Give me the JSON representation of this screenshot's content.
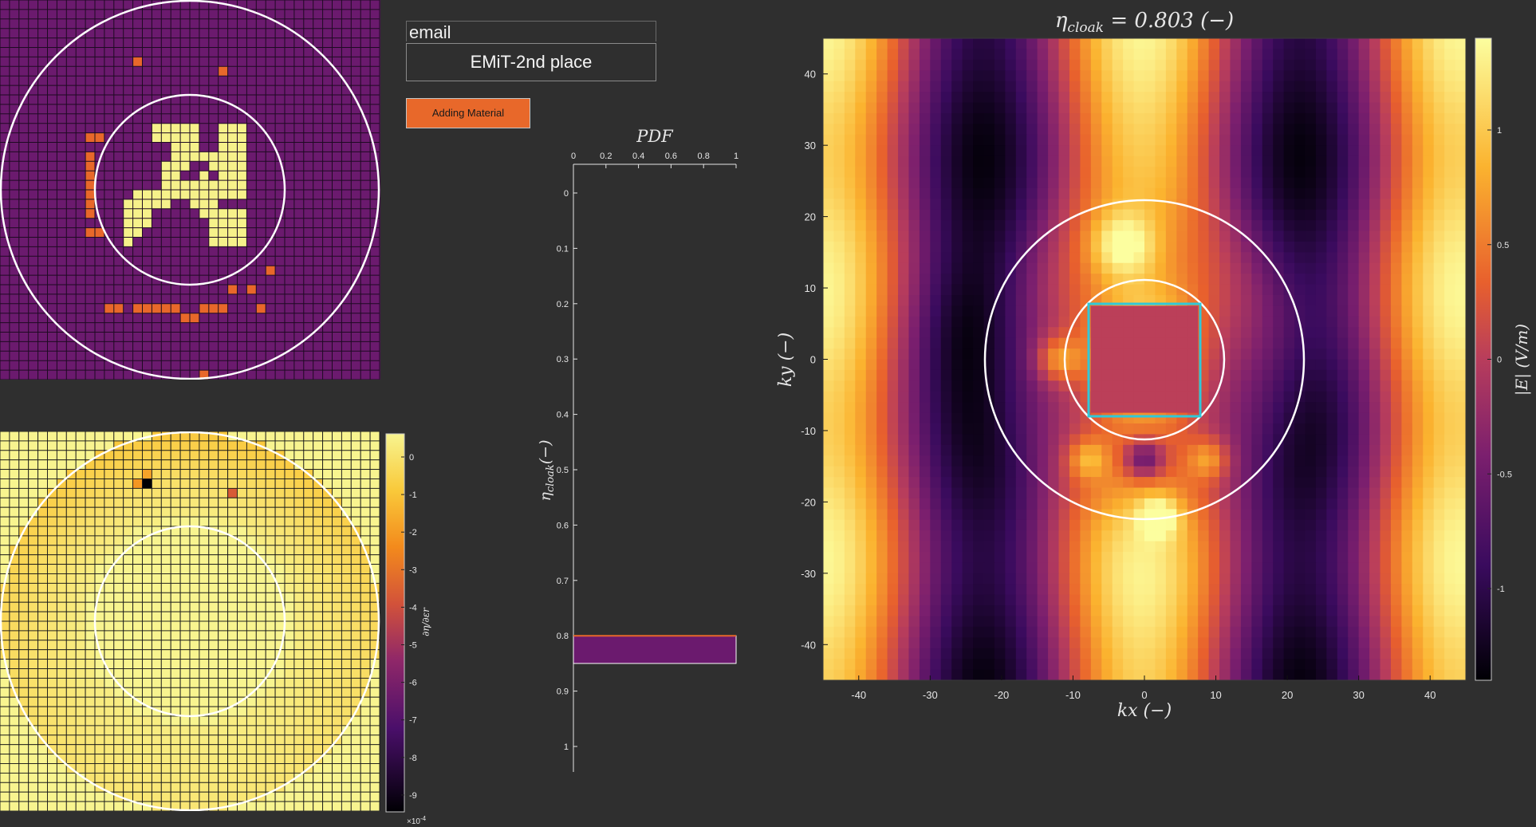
{
  "controls": {
    "email_value": "email",
    "team_label": "EMiT-2nd place",
    "adding_material_label": "Adding Material"
  },
  "colors": {
    "background": "#2f2f2f",
    "design_bg": "#6b1a6e",
    "design_material": "#f6f18a",
    "design_adding": "#e8682a",
    "cloak_outline": "#30c8d8",
    "circle": "#ffffff"
  },
  "design_grid": {
    "cells": 40,
    "material_cells": [
      [
        16,
        13
      ],
      [
        17,
        13
      ],
      [
        18,
        13
      ],
      [
        19,
        13
      ],
      [
        20,
        13
      ],
      [
        23,
        13
      ],
      [
        24,
        13
      ],
      [
        25,
        13
      ],
      [
        16,
        14
      ],
      [
        17,
        14
      ],
      [
        18,
        14
      ],
      [
        19,
        14
      ],
      [
        20,
        14
      ],
      [
        23,
        14
      ],
      [
        24,
        14
      ],
      [
        25,
        14
      ],
      [
        18,
        15
      ],
      [
        19,
        15
      ],
      [
        20,
        15
      ],
      [
        23,
        15
      ],
      [
        24,
        15
      ],
      [
        25,
        15
      ],
      [
        18,
        16
      ],
      [
        19,
        16
      ],
      [
        20,
        16
      ],
      [
        21,
        16
      ],
      [
        22,
        16
      ],
      [
        23,
        16
      ],
      [
        24,
        16
      ],
      [
        25,
        16
      ],
      [
        17,
        17
      ],
      [
        18,
        17
      ],
      [
        19,
        17
      ],
      [
        22,
        17
      ],
      [
        23,
        17
      ],
      [
        24,
        17
      ],
      [
        25,
        17
      ],
      [
        17,
        18
      ],
      [
        18,
        18
      ],
      [
        21,
        18
      ],
      [
        23,
        18
      ],
      [
        24,
        18
      ],
      [
        25,
        18
      ],
      [
        17,
        19
      ],
      [
        18,
        19
      ],
      [
        19,
        19
      ],
      [
        20,
        19
      ],
      [
        21,
        19
      ],
      [
        22,
        19
      ],
      [
        23,
        19
      ],
      [
        24,
        19
      ],
      [
        25,
        19
      ],
      [
        14,
        20
      ],
      [
        15,
        20
      ],
      [
        16,
        20
      ],
      [
        17,
        20
      ],
      [
        18,
        20
      ],
      [
        19,
        20
      ],
      [
        20,
        20
      ],
      [
        21,
        20
      ],
      [
        22,
        20
      ],
      [
        23,
        20
      ],
      [
        24,
        20
      ],
      [
        25,
        20
      ],
      [
        13,
        21
      ],
      [
        14,
        21
      ],
      [
        15,
        21
      ],
      [
        16,
        21
      ],
      [
        17,
        21
      ],
      [
        20,
        21
      ],
      [
        21,
        21
      ],
      [
        22,
        21
      ],
      [
        13,
        22
      ],
      [
        14,
        22
      ],
      [
        15,
        22
      ],
      [
        21,
        22
      ],
      [
        22,
        22
      ],
      [
        23,
        22
      ],
      [
        24,
        22
      ],
      [
        25,
        22
      ],
      [
        13,
        23
      ],
      [
        14,
        23
      ],
      [
        15,
        23
      ],
      [
        22,
        23
      ],
      [
        23,
        23
      ],
      [
        24,
        23
      ],
      [
        25,
        23
      ],
      [
        13,
        24
      ],
      [
        14,
        24
      ],
      [
        22,
        24
      ],
      [
        23,
        24
      ],
      [
        24,
        24
      ],
      [
        25,
        24
      ],
      [
        13,
        25
      ],
      [
        22,
        25
      ],
      [
        23,
        25
      ],
      [
        24,
        25
      ],
      [
        25,
        25
      ]
    ],
    "adding_cells": [
      [
        14,
        6
      ],
      [
        23,
        7
      ],
      [
        9,
        14
      ],
      [
        10,
        14
      ],
      [
        9,
        16
      ],
      [
        9,
        17
      ],
      [
        9,
        18
      ],
      [
        9,
        19
      ],
      [
        9,
        20
      ],
      [
        9,
        21
      ],
      [
        9,
        22
      ],
      [
        10,
        24
      ],
      [
        9,
        24
      ],
      [
        28,
        28
      ],
      [
        24,
        30
      ],
      [
        26,
        30
      ],
      [
        11,
        32
      ],
      [
        12,
        32
      ],
      [
        14,
        32
      ],
      [
        15,
        32
      ],
      [
        16,
        32
      ],
      [
        17,
        32
      ],
      [
        18,
        32
      ],
      [
        21,
        32
      ],
      [
        22,
        32
      ],
      [
        23,
        32
      ],
      [
        27,
        32
      ],
      [
        19,
        33
      ],
      [
        20,
        33
      ],
      [
        21,
        39
      ]
    ]
  },
  "sensitivity_map": {
    "colorbar_ticks": [
      "0",
      "-1",
      "-2",
      "-3",
      "-4",
      "-5",
      "-6",
      "-7",
      "-8",
      "-9"
    ],
    "colorbar_exponent": "×10",
    "colorbar_exponent_power": "-4",
    "colorbar_label": "∂η/∂εr"
  },
  "pdf_chart": {
    "title": "PDF",
    "x_ticks": [
      "0",
      "0.2",
      "0.4",
      "0.6",
      "0.8",
      "1"
    ],
    "y_ticks": [
      "0",
      "0.1",
      "0.2",
      "0.3",
      "0.4",
      "0.5",
      "0.6",
      "0.7",
      "0.8",
      "0.9",
      "1"
    ],
    "ylabel": "η",
    "ylabel_sub": "cloak",
    "ylabel_unit": "(−)"
  },
  "field_map": {
    "title_symbol": "η",
    "title_sub": "cloak",
    "title_value": " = 0.803 (−)",
    "x_ticks": [
      "-40",
      "-30",
      "-20",
      "-10",
      "0",
      "10",
      "20",
      "30",
      "40"
    ],
    "y_ticks": [
      "40",
      "30",
      "20",
      "10",
      "0",
      "-10",
      "-20",
      "-30",
      "-40"
    ],
    "xlabel": "kx (−)",
    "ylabel": "ky (−)",
    "colorbar_ticks": [
      "1",
      "0.5",
      "0",
      "-0.5",
      "-1"
    ],
    "colorbar_label": "|E| (V/m)"
  },
  "chart_data": [
    {
      "type": "bar",
      "title": "PDF",
      "orientation": "horizontal",
      "ylabel": "η_cloak (−)",
      "xlim": [
        0,
        1
      ],
      "ylim": [
        0,
        1
      ],
      "bars": [
        {
          "y_from": 0.8,
          "y_to": 0.85,
          "value": 1
        }
      ]
    },
    {
      "type": "heatmap",
      "title": "η_cloak = 0.803 (−)",
      "xlabel": "kx (−)",
      "ylabel": "ky (−)",
      "xlim": [
        -45,
        45
      ],
      "ylim": [
        -45,
        45
      ],
      "colorbar_label": "|E| (V/m)",
      "clim": [
        -1.4,
        1.4
      ]
    }
  ]
}
